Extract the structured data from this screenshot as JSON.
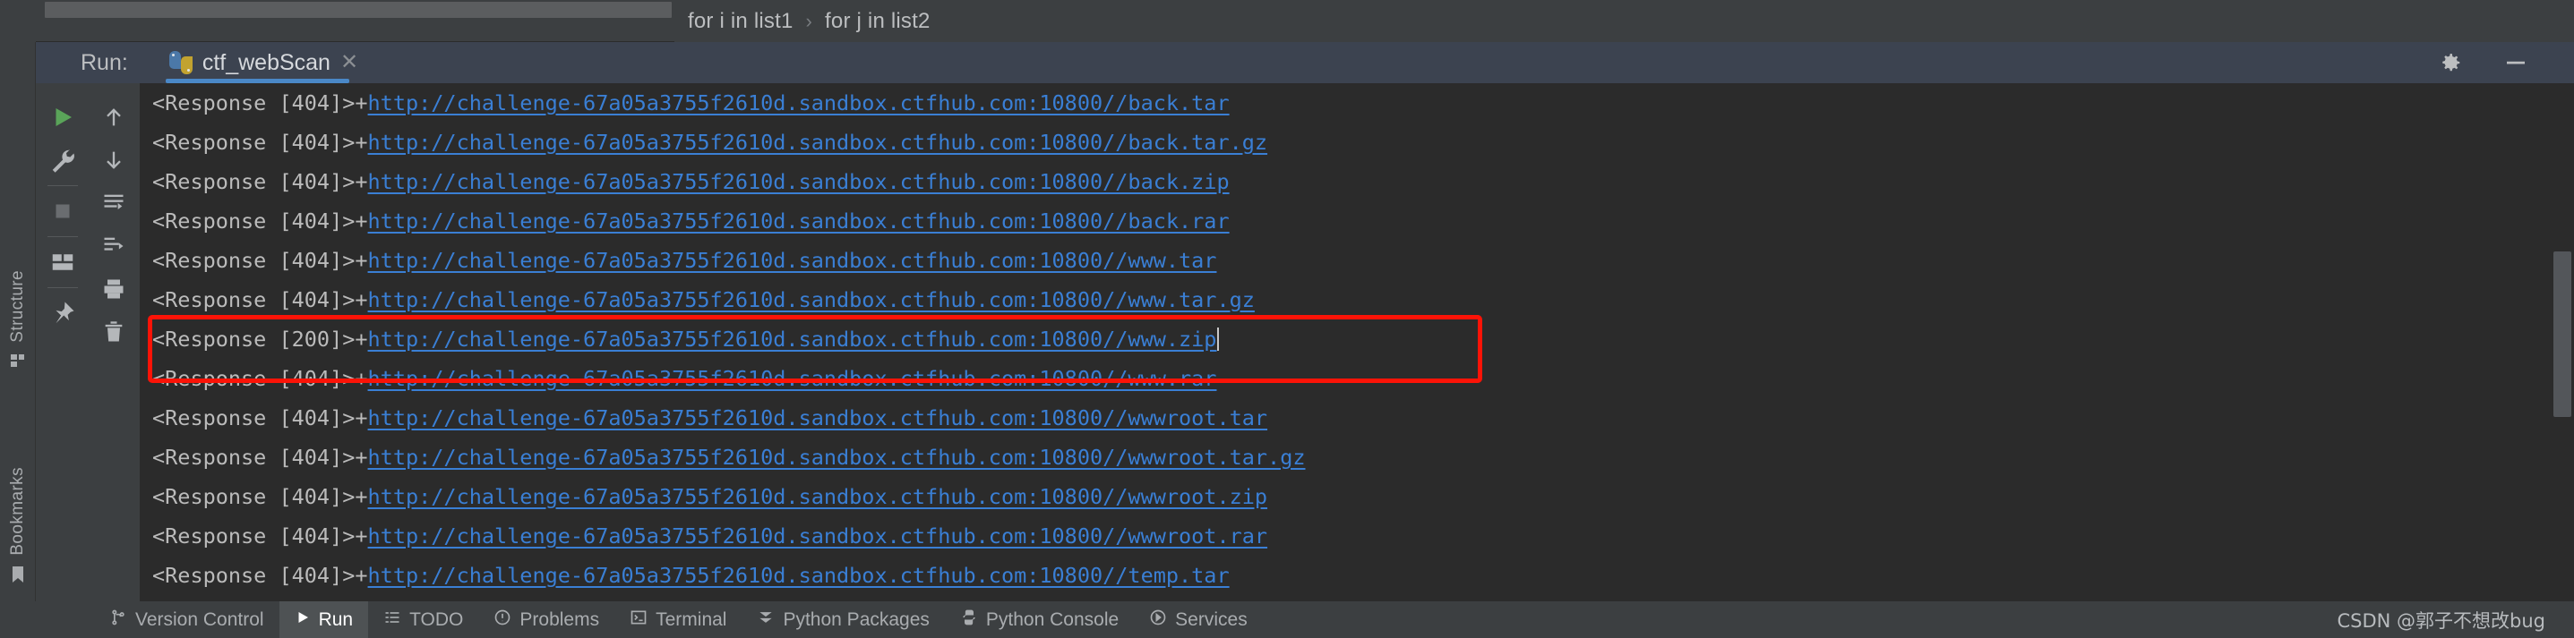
{
  "breadcrumb": {
    "items": [
      "for i in list1",
      "for j in list2"
    ],
    "separator": "›"
  },
  "run_panel": {
    "run_label": "Run:",
    "tab_name": "ctf_webScan",
    "tab_close": "✕",
    "tab_icon": "python-icon",
    "settings_icon": "gear-icon",
    "minimize_icon": "minimize-icon"
  },
  "left_toolbar": {
    "column_one": [
      "run-icon",
      "wrench-icon",
      "stop-icon",
      "layout-icon",
      "pin-icon"
    ],
    "column_two": [
      "arrow-up-icon",
      "arrow-down-icon",
      "soft-wrap-icon",
      "scroll-to-end-icon",
      "print-icon",
      "trash-icon"
    ]
  },
  "left_sidebar": {
    "items": [
      {
        "label": "Structure",
        "icon": "structure-icon"
      },
      {
        "label": "Bookmarks",
        "icon": "bookmark-icon"
      }
    ]
  },
  "console": {
    "host": "http://challenge-67a05a3755f2610d.sandbox.ctfhub.com:10800//",
    "prefix_ok": "<Response [200]>+",
    "prefix_notfound": "<Response [404]>+",
    "lines": [
      {
        "prefix": "<Response [404]>+",
        "url": "http://challenge-67a05a3755f2610d.sandbox.ctfhub.com:10800//back.tar",
        "status": "404",
        "highlighted": false
      },
      {
        "prefix": "<Response [404]>+",
        "url": "http://challenge-67a05a3755f2610d.sandbox.ctfhub.com:10800//back.tar.gz",
        "status": "404",
        "highlighted": false
      },
      {
        "prefix": "<Response [404]>+",
        "url": "http://challenge-67a05a3755f2610d.sandbox.ctfhub.com:10800//back.zip",
        "status": "404",
        "highlighted": false
      },
      {
        "prefix": "<Response [404]>+",
        "url": "http://challenge-67a05a3755f2610d.sandbox.ctfhub.com:10800//back.rar",
        "status": "404",
        "highlighted": false
      },
      {
        "prefix": "<Response [404]>+",
        "url": "http://challenge-67a05a3755f2610d.sandbox.ctfhub.com:10800//www.tar",
        "status": "404",
        "highlighted": false
      },
      {
        "prefix": "<Response [404]>+",
        "url": "http://challenge-67a05a3755f2610d.sandbox.ctfhub.com:10800//www.tar.gz",
        "status": "404",
        "highlighted": false
      },
      {
        "prefix": "<Response [200]>+",
        "url": "http://challenge-67a05a3755f2610d.sandbox.ctfhub.com:10800//www.zip",
        "status": "200",
        "highlighted": true
      },
      {
        "prefix": "<Response [404]>+",
        "url": "http://challenge-67a05a3755f2610d.sandbox.ctfhub.com:10800//www.rar",
        "status": "404",
        "highlighted": false
      },
      {
        "prefix": "<Response [404]>+",
        "url": "http://challenge-67a05a3755f2610d.sandbox.ctfhub.com:10800//wwwroot.tar",
        "status": "404",
        "highlighted": false
      },
      {
        "prefix": "<Response [404]>+",
        "url": "http://challenge-67a05a3755f2610d.sandbox.ctfhub.com:10800//wwwroot.tar.gz",
        "status": "404",
        "highlighted": false
      },
      {
        "prefix": "<Response [404]>+",
        "url": "http://challenge-67a05a3755f2610d.sandbox.ctfhub.com:10800//wwwroot.zip",
        "status": "404",
        "highlighted": false
      },
      {
        "prefix": "<Response [404]>+",
        "url": "http://challenge-67a05a3755f2610d.sandbox.ctfhub.com:10800//wwwroot.rar",
        "status": "404",
        "highlighted": false
      },
      {
        "prefix": "<Response [404]>+",
        "url": "http://challenge-67a05a3755f2610d.sandbox.ctfhub.com:10800//temp.tar",
        "status": "404",
        "highlighted": false
      }
    ]
  },
  "statusbar": {
    "items": [
      {
        "label": "Version Control",
        "icon": "branch-icon",
        "active": false
      },
      {
        "label": "Run",
        "icon": "play-icon",
        "active": true
      },
      {
        "label": "TODO",
        "icon": "list-icon",
        "active": false
      },
      {
        "label": "Problems",
        "icon": "error-icon",
        "active": false
      },
      {
        "label": "Terminal",
        "icon": "terminal-icon",
        "active": false
      },
      {
        "label": "Python Packages",
        "icon": "packages-icon",
        "active": false
      },
      {
        "label": "Python Console",
        "icon": "python-console-icon",
        "active": false
      },
      {
        "label": "Services",
        "icon": "services-icon",
        "active": false
      }
    ],
    "watermark": "CSDN @郭子不想改bug"
  },
  "colors": {
    "link": "#3a7fd5",
    "highlight_box": "#fc1307",
    "tab_accent": "#4a88c7",
    "console_bg": "#2b2b2b",
    "chrome_bg": "#3c3f41"
  }
}
